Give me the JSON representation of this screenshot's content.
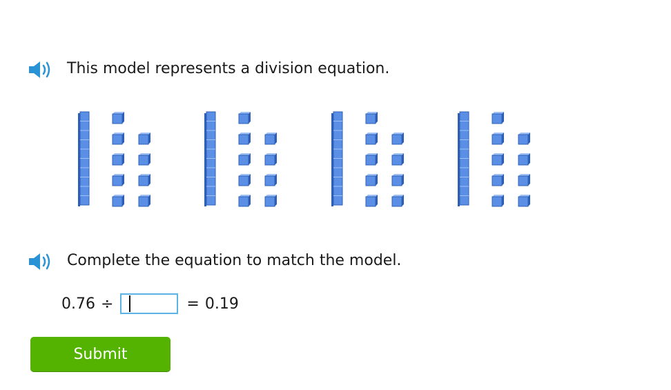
{
  "prompts": [
    {
      "text": "This model represents a division equation."
    },
    {
      "text": "Complete the equation to match the model."
    }
  ],
  "model": {
    "groups": 4,
    "rods_per_group": 1,
    "cubes_per_group": 9,
    "rod_represents": "tenth",
    "cube_represents": "hundredth"
  },
  "equation": {
    "dividend": "0.76",
    "operator": "÷",
    "divisor_value": "",
    "equals": "=",
    "quotient": "0.19"
  },
  "submit": {
    "label": "Submit"
  },
  "colors": {
    "block_fill": "#5b8fe6",
    "block_dark": "#2d5fb7",
    "block_light": "#9fc0f5",
    "speaker": "#2a93d6",
    "input_border": "#5ab4e6",
    "submit_bg": "#54b300"
  },
  "icons": {
    "speaker": "speaker-icon"
  }
}
